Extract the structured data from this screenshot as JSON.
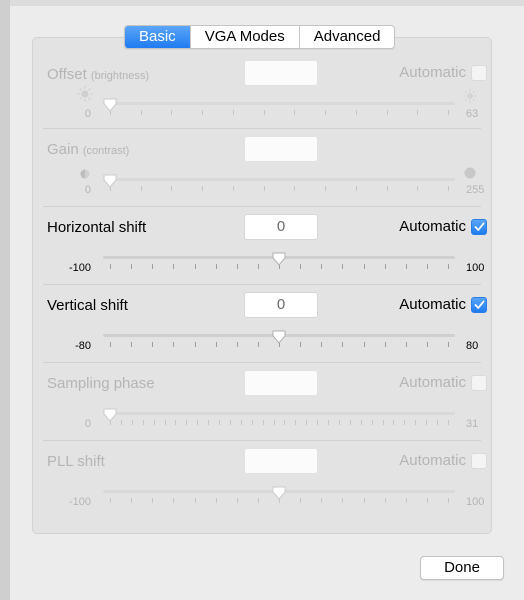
{
  "tabs": [
    {
      "label": "Basic",
      "active": true
    },
    {
      "label": "VGA Modes",
      "active": false
    },
    {
      "label": "Advanced",
      "active": false
    }
  ],
  "controls": [
    {
      "id": "offset",
      "label": "Offset",
      "sub_label": "(brightness)",
      "value": "",
      "automatic_label": "Automatic",
      "automatic_checked": false,
      "enabled": false,
      "min": "0",
      "max": "63",
      "slider_fraction": 0,
      "tick_count": 12,
      "min_icon": "sun-small-icon",
      "max_icon": "sun-large-icon"
    },
    {
      "id": "gain",
      "label": "Gain",
      "sub_label": "(contrast)",
      "value": "",
      "automatic_label": "",
      "automatic_checked": false,
      "enabled": false,
      "min": "0",
      "max": "255",
      "slider_fraction": 0,
      "tick_count": 12,
      "min_icon": "contrast-small-icon",
      "max_icon": "contrast-large-icon"
    },
    {
      "id": "hshift",
      "label": "Horizontal shift",
      "sub_label": "",
      "value": "0",
      "automatic_label": "Automatic",
      "automatic_checked": true,
      "enabled": true,
      "min": "-100",
      "max": "100",
      "slider_fraction": 0.5,
      "tick_count": 17
    },
    {
      "id": "vshift",
      "label": "Vertical shift",
      "sub_label": "",
      "value": "0",
      "automatic_label": "Automatic",
      "automatic_checked": true,
      "enabled": true,
      "min": "-80",
      "max": "80",
      "slider_fraction": 0.5,
      "tick_count": 17
    },
    {
      "id": "phase",
      "label": "Sampling phase",
      "sub_label": "",
      "value": "",
      "automatic_label": "Automatic",
      "automatic_checked": false,
      "enabled": false,
      "min": "0",
      "max": "31",
      "slider_fraction": 0,
      "tick_count": 32
    },
    {
      "id": "pll",
      "label": "PLL shift",
      "sub_label": "",
      "value": "",
      "automatic_label": "Automatic",
      "automatic_checked": false,
      "enabled": false,
      "min": "-100",
      "max": "100",
      "slider_fraction": 0.5,
      "tick_count": 17
    }
  ],
  "done_label": "Done",
  "colors": {
    "accent": "#1f7bf2",
    "disabled_text": "#b5b5b5"
  }
}
